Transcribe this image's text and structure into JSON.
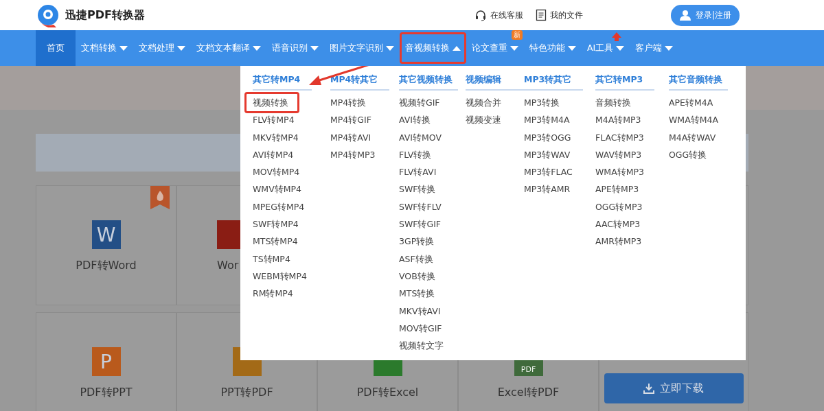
{
  "header": {
    "logo_text": "迅捷PDF转换器",
    "links": [
      {
        "kind": "service",
        "label": "在线客服"
      },
      {
        "kind": "files",
        "label": "我的文件"
      }
    ],
    "login_label": "登录|注册"
  },
  "nav": [
    {
      "label": "首页",
      "selected": true,
      "highlighted": false,
      "hot": false
    },
    {
      "label": "文档转换",
      "selected": false,
      "expanded": false,
      "highlighted": false,
      "hot": false
    },
    {
      "label": "文档处理",
      "selected": false,
      "expanded": false,
      "highlighted": false,
      "hot": false
    },
    {
      "label": "文档文本翻译",
      "selected": false,
      "expanded": false,
      "highlighted": false,
      "hot": false
    },
    {
      "label": "语音识别",
      "selected": false,
      "expanded": false,
      "highlighted": false,
      "hot": false
    },
    {
      "label": "图片文字识别",
      "selected": false,
      "expanded": false,
      "highlighted": false,
      "hot": false
    },
    {
      "label": "音视频转换",
      "selected": false,
      "expanded": true,
      "highlighted": true,
      "hot": false
    },
    {
      "label": "论文查重",
      "selected": false,
      "expanded": false,
      "highlighted": false,
      "hot": false,
      "badge": "新"
    },
    {
      "label": "特色功能",
      "selected": false,
      "expanded": false,
      "highlighted": false,
      "hot": false
    },
    {
      "label": "AI工具",
      "selected": false,
      "expanded": false,
      "highlighted": false,
      "hot": true
    },
    {
      "label": "客户端",
      "selected": false,
      "expanded": false,
      "highlighted": false,
      "hot": false
    }
  ],
  "dropdown": {
    "columns": [
      {
        "title": "其它转MP4",
        "items": [
          {
            "label": "视频转换",
            "highlighted": true
          },
          {
            "label": "FLV转MP4",
            "highlighted": false
          },
          {
            "label": "MKV转MP4",
            "highlighted": false
          },
          {
            "label": "AVI转MP4",
            "highlighted": false
          },
          {
            "label": "MOV转MP4",
            "highlighted": false
          },
          {
            "label": "WMV转MP4",
            "highlighted": false
          },
          {
            "label": "MPEG转MP4",
            "highlighted": false
          },
          {
            "label": "SWF转MP4",
            "highlighted": false
          },
          {
            "label": "MTS转MP4",
            "highlighted": false
          },
          {
            "label": "TS转MP4",
            "highlighted": false
          },
          {
            "label": "WEBM转MP4",
            "highlighted": false
          },
          {
            "label": "RM转MP4",
            "highlighted": false
          }
        ]
      },
      {
        "title": "MP4转其它",
        "items": [
          {
            "label": "MP4转换",
            "highlighted": false
          },
          {
            "label": "MP4转GIF",
            "highlighted": false
          },
          {
            "label": "MP4转AVI",
            "highlighted": false
          },
          {
            "label": "MP4转MP3",
            "highlighted": false
          }
        ]
      },
      {
        "title": "其它视频转换",
        "items": [
          {
            "label": "视频转GIF",
            "highlighted": false
          },
          {
            "label": "AVI转换",
            "highlighted": false
          },
          {
            "label": "AVI转MOV",
            "highlighted": false
          },
          {
            "label": "FLV转换",
            "highlighted": false
          },
          {
            "label": "FLV转AVI",
            "highlighted": false
          },
          {
            "label": "SWF转换",
            "highlighted": false
          },
          {
            "label": "SWF转FLV",
            "highlighted": false
          },
          {
            "label": "SWF转GIF",
            "highlighted": false
          },
          {
            "label": "3GP转换",
            "highlighted": false
          },
          {
            "label": "ASF转换",
            "highlighted": false
          },
          {
            "label": "VOB转换",
            "highlighted": false
          },
          {
            "label": "MTS转换",
            "highlighted": false
          },
          {
            "label": "MKV转AVI",
            "highlighted": false
          },
          {
            "label": "MOV转GIF",
            "highlighted": false
          },
          {
            "label": "视频转文字",
            "highlighted": false
          }
        ]
      },
      {
        "title": "视频编辑",
        "items": [
          {
            "label": "视频合并",
            "highlighted": false
          },
          {
            "label": "视频变速",
            "highlighted": false
          }
        ]
      },
      {
        "title": "MP3转其它",
        "items": [
          {
            "label": "MP3转换",
            "highlighted": false
          },
          {
            "label": "MP3转M4A",
            "highlighted": false
          },
          {
            "label": "MP3转OGG",
            "highlighted": false
          },
          {
            "label": "MP3转WAV",
            "highlighted": false
          },
          {
            "label": "MP3转FLAC",
            "highlighted": false
          },
          {
            "label": "MP3转AMR",
            "highlighted": false
          }
        ]
      },
      {
        "title": "其它转MP3",
        "items": [
          {
            "label": "音频转换",
            "highlighted": false
          },
          {
            "label": "M4A转MP3",
            "highlighted": false
          },
          {
            "label": "FLAC转MP3",
            "highlighted": false
          },
          {
            "label": "WAV转MP3",
            "highlighted": false
          },
          {
            "label": "WMA转MP3",
            "highlighted": false
          },
          {
            "label": "APE转MP3",
            "highlighted": false
          },
          {
            "label": "OGG转MP3",
            "highlighted": false
          },
          {
            "label": "AAC转MP3",
            "highlighted": false
          },
          {
            "label": "AMR转MP3",
            "highlighted": false
          }
        ]
      },
      {
        "title": "其它音频转换",
        "items": [
          {
            "label": "APE转M4A",
            "highlighted": false
          },
          {
            "label": "WMA转M4A",
            "highlighted": false
          },
          {
            "label": "M4A转WAV",
            "highlighted": false
          },
          {
            "label": "OGG转换",
            "highlighted": false
          }
        ]
      }
    ]
  },
  "cards": [
    {
      "label": "PDF转Word",
      "kind": "word",
      "glyph": "W",
      "hot": true
    },
    {
      "label": "Wor",
      "kind": "red",
      "hot": false
    },
    {
      "label": "PDF转PPT",
      "kind": "ppt",
      "glyph": "P",
      "hot": false
    },
    {
      "label": "PPT转PDF",
      "kind": "ppt-pdf",
      "hot": false
    },
    {
      "label": "PDF转Excel",
      "kind": "excel",
      "hot": false
    },
    {
      "label": "Excel转PDF",
      "kind": "excel-pdf",
      "glyph": "PDF",
      "hot": false
    }
  ],
  "download_button": "立即下载"
}
